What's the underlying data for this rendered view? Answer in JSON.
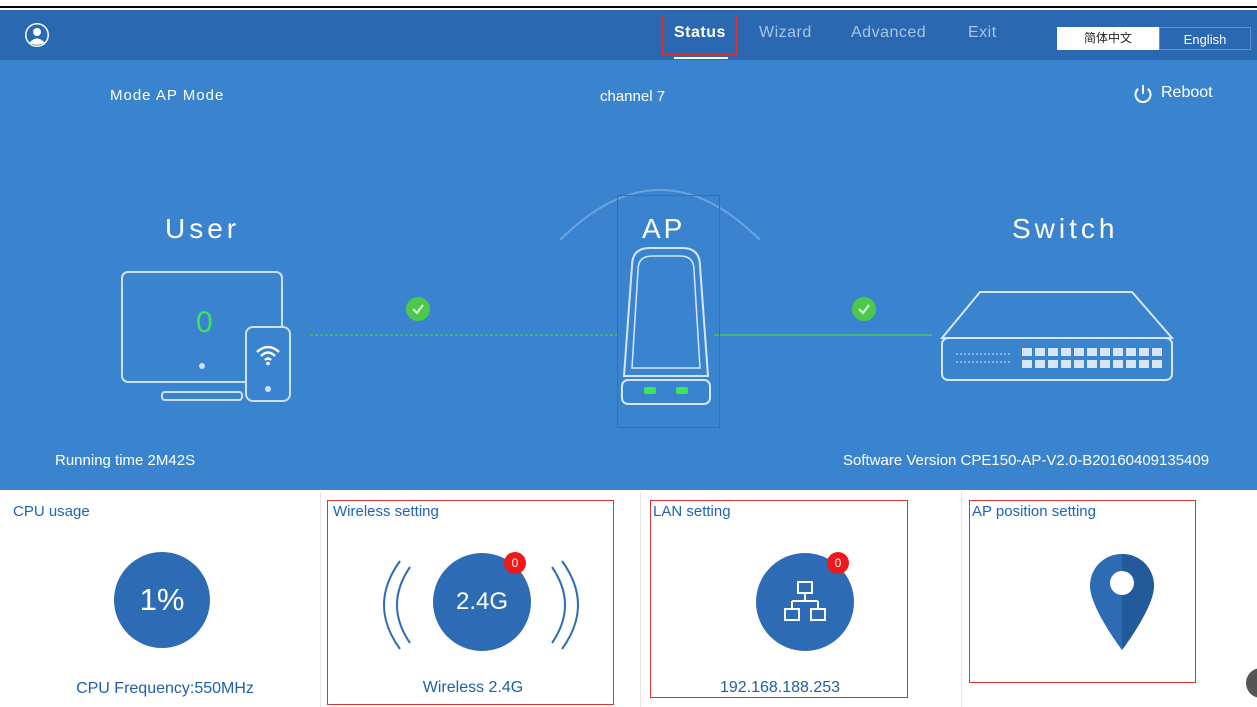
{
  "nav": {
    "items": [
      {
        "label": "Status",
        "active": true
      },
      {
        "label": "Wizard",
        "active": false
      },
      {
        "label": "Advanced",
        "active": false
      },
      {
        "label": "Exit",
        "active": false
      }
    ],
    "lang_cn": "简体中文",
    "lang_en": "English"
  },
  "status": {
    "mode": "Mode  AP Mode",
    "channel": "channel 7",
    "reboot": "Reboot",
    "user_title": "User",
    "ap_title": "AP",
    "switch_title": "Switch",
    "user_count": "0",
    "running_time": "Running time  2M42S",
    "software_version": "Software Version  CPE150-AP-V2.0-B20160409135409"
  },
  "panels": {
    "cpu": {
      "title": "CPU usage",
      "value": "1%",
      "footer": "CPU Frequency:550MHz"
    },
    "wireless": {
      "title": "Wireless setting",
      "value": "2.4G",
      "badge": "0",
      "footer": "Wireless 2.4G"
    },
    "lan": {
      "title": "LAN setting",
      "badge": "0",
      "footer": "192.168.188.253"
    },
    "ap_position": {
      "title": "AP position setting"
    }
  },
  "colors": {
    "navbar": "#2a68b1",
    "hero": "#3a84cf",
    "accent_green": "#3ecb5a",
    "circle_blue": "#2d6cb4",
    "badge_red": "#f01818",
    "highlight_red": "#e03030"
  },
  "icons": [
    "user-avatar-icon",
    "power-icon",
    "monitor-icon",
    "phone-icon",
    "wifi-icon",
    "check-icon",
    "ap-device-icon",
    "switch-device-icon",
    "wireless-wave-icon",
    "network-icon",
    "location-pin-icon"
  ]
}
